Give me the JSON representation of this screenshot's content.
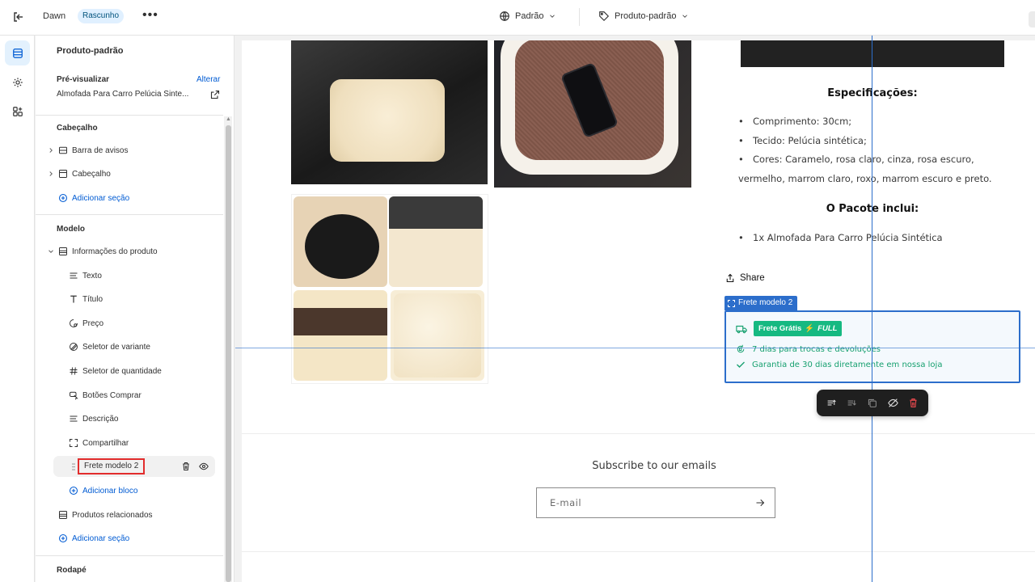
{
  "topbar": {
    "exit_icon": "exit-icon",
    "theme_name": "Dawn",
    "status_badge": "Rascunho",
    "more_label": "•••",
    "preset_label": "Padrão",
    "template_label": "Produto-padrão"
  },
  "sidebar": {
    "title": "Produto-padrão",
    "preview_label": "Pré-visualizar",
    "preview_change": "Alterar",
    "preview_value": "Almofada Para Carro Pelúcia Sinte...",
    "header_section": "Cabeçalho",
    "header_items": [
      {
        "label": "Barra de avisos",
        "icon": "layout-icon"
      },
      {
        "label": "Cabeçalho",
        "icon": "layout-icon"
      }
    ],
    "add_section": "Adicionar seção",
    "template_section": "Modelo",
    "product_info": "Informações do produto",
    "blocks": [
      {
        "label": "Texto",
        "icon": "text-icon"
      },
      {
        "label": "Título",
        "icon": "title-icon"
      },
      {
        "label": "Preço",
        "icon": "price-tag-icon"
      },
      {
        "label": "Seletor de variante",
        "icon": "variant-icon"
      },
      {
        "label": "Seletor de quantidade",
        "icon": "hash-icon"
      },
      {
        "label": "Botões Comprar",
        "icon": "buy-button-icon"
      },
      {
        "label": "Descrição",
        "icon": "text-icon"
      },
      {
        "label": "Compartilhar",
        "icon": "share-frame-icon"
      }
    ],
    "selected_block": "Frete modelo 2",
    "add_block": "Adicionar bloco",
    "related_products": "Produtos relacionados",
    "add_section_2": "Adicionar seção",
    "footer_section": "Rodapé"
  },
  "preview": {
    "spec_heading": "Especificações:",
    "spec_items": [
      "Comprimento: 30cm;",
      "Tecido: Pelúcia sintética;",
      "Cores: Caramelo, rosa claro, cinza, rosa escuro,"
    ],
    "spec_wrap": "vermelho, marrom claro, roxo, marrom escuro e preto.",
    "pack_heading": "O Pacote inclui:",
    "pack_items": [
      "1x Almofada Para Carro Pelúcia Sintética"
    ],
    "share_label": "Share",
    "block_tag": "Frete modelo 2",
    "free_shipping": "Frete Grátis",
    "full_label": "FULL",
    "returns_text": "7 dias para trocas e devoluções",
    "warranty_text": "Garantia de 30 dias diretamente em nossa loja",
    "subscribe_heading": "Subscribe to our emails",
    "email_placeholder": "E-mail"
  },
  "colors": {
    "accent": "#005bd3",
    "selection": "#2c6ecb",
    "success": "#16b981",
    "highlight_box": "#e22c2c"
  }
}
